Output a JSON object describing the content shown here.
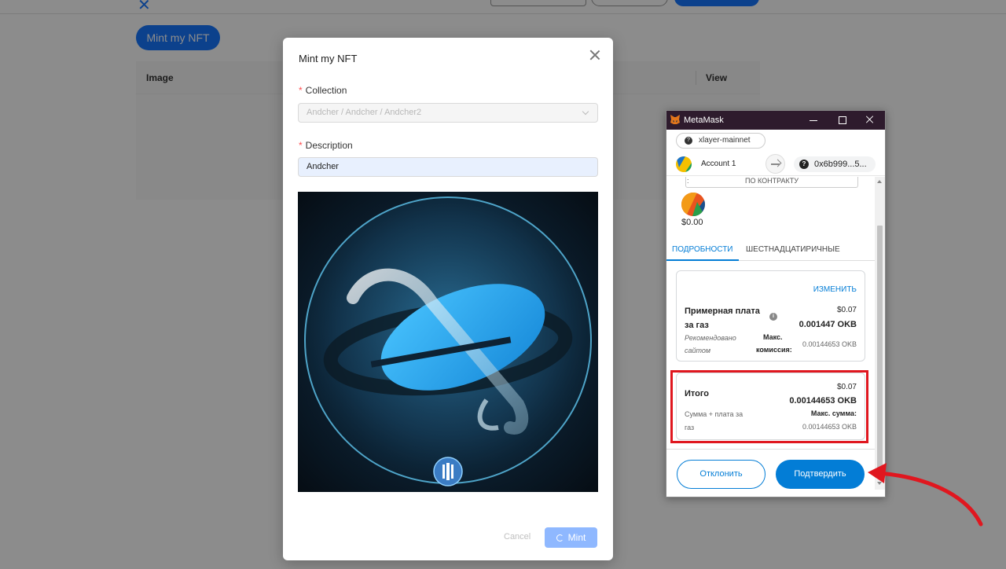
{
  "background": {
    "mint_button_label": "Mint my NFT",
    "table_headers": [
      "Image",
      "View"
    ]
  },
  "modal": {
    "title": "Mint my NFT",
    "collection_label": "Collection",
    "collection_value": "Andcher / Andcher / Andcher2",
    "description_label": "Description",
    "description_value": "Andcher",
    "cancel_label": "Cancel",
    "mint_label": "Mint"
  },
  "metamask": {
    "window_title": "MetaMask",
    "network": "xlayer-mainnet",
    "account_name": "Account 1",
    "address": "0x6b999...5...",
    "contract_chip": "ПО КОНТРАКТУ",
    "amount": "$0.00",
    "tabs": [
      "ПОДРОБНОСТИ",
      "ШЕСТНАДЦАТИРИЧНЫЕ"
    ],
    "gas": {
      "edit_label": "ИЗМЕНИТЬ",
      "title_line1": "Примерная плата",
      "title_line2": "за газ",
      "usd": "$0.07",
      "okb": "0.001447 OKB",
      "recommended_line1": "Рекомендовано",
      "recommended_line2": "сайтом",
      "max_label_line1": "Макс.",
      "max_label_line2": "комиссия:",
      "max_value": "0.00144653 OKB"
    },
    "total": {
      "title": "Итого",
      "usd": "$0.07",
      "okb": "0.00144653 OKB",
      "sub_line1": "Сумма + плата за",
      "sub_line2": "газ",
      "max_label": "Макс. сумма:",
      "max_value": "0.00144653 OKB"
    },
    "reject_label": "Отклонить",
    "confirm_label": "Подтвердить"
  },
  "colors": {
    "primary_blue": "#1677ff",
    "metamask_blue": "#037dd6",
    "annotation_red": "#e0171f",
    "metamask_titlebar": "#2e1b2d"
  }
}
